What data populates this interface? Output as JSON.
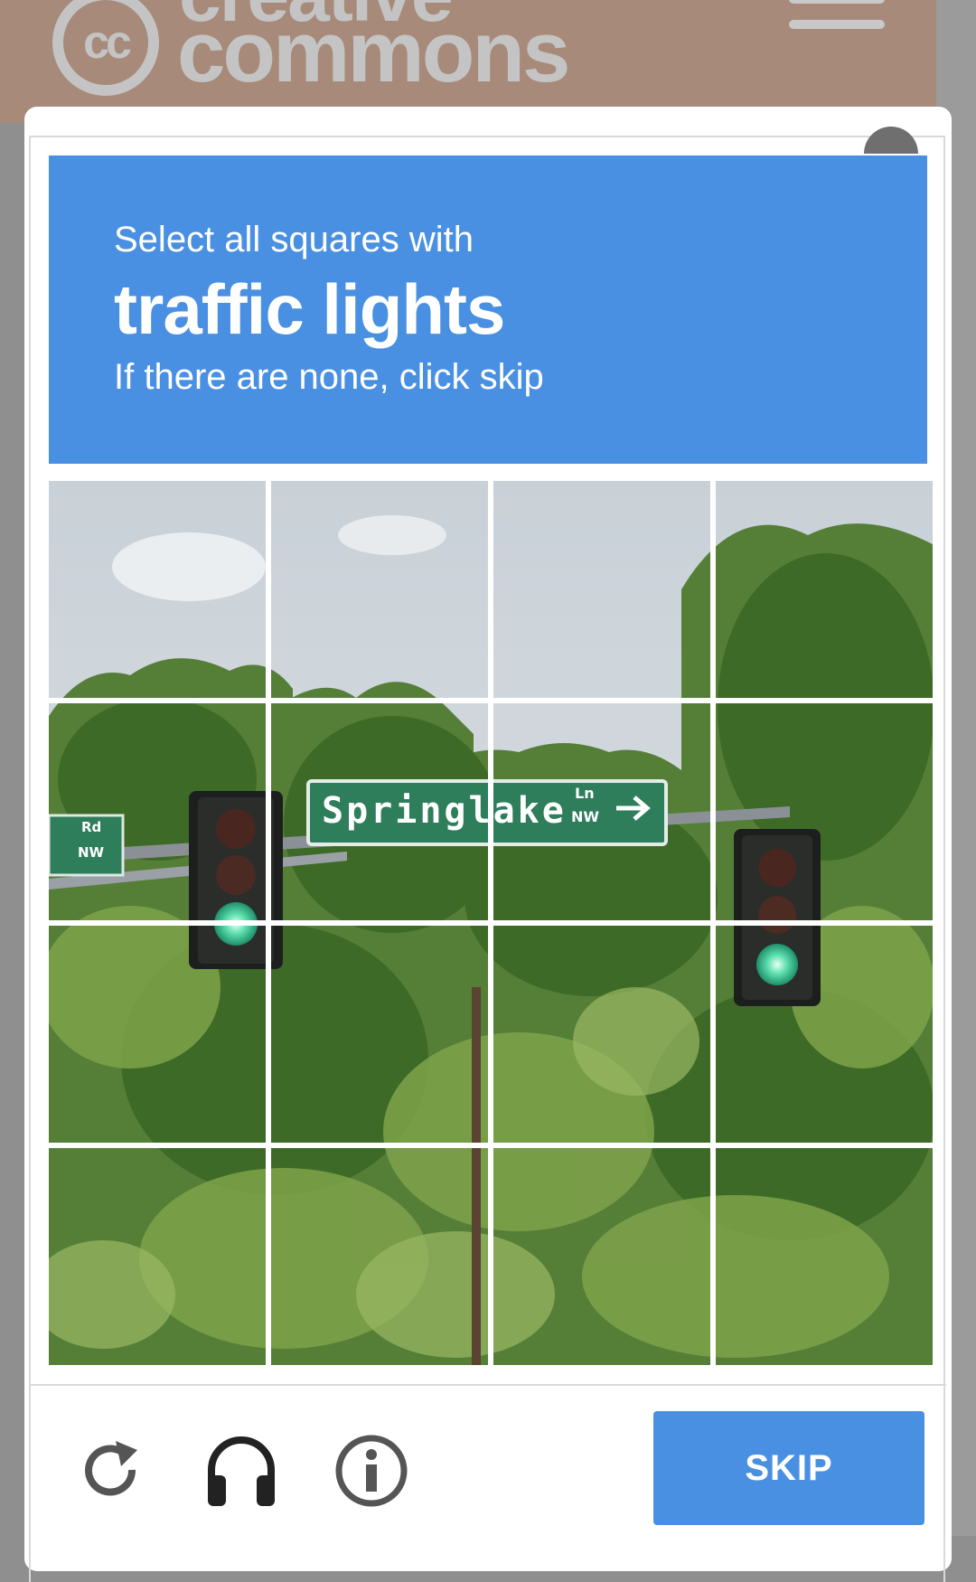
{
  "site": {
    "logo_mark": "cc",
    "logo_word_1": "creative",
    "logo_word_2": "commons"
  },
  "captcha": {
    "instruction": "Select all squares with",
    "target": "traffic lights",
    "hint": "If there are none, click skip",
    "grid": {
      "rows": 4,
      "columns": 4
    },
    "sign_text": "Springlake",
    "sign_suffix_top": "Ln",
    "sign_suffix_bottom": "NW",
    "left_sign_top": "Rd",
    "left_sign_bottom": "NW",
    "skip_label": "SKIP",
    "icons": [
      "reload-icon",
      "audio-headphones-icon",
      "info-icon"
    ],
    "colors": {
      "accent": "#4a90e2",
      "sky": "#d8dde0",
      "foliage": "#4f7a33",
      "sign": "#2e7d5b"
    }
  }
}
